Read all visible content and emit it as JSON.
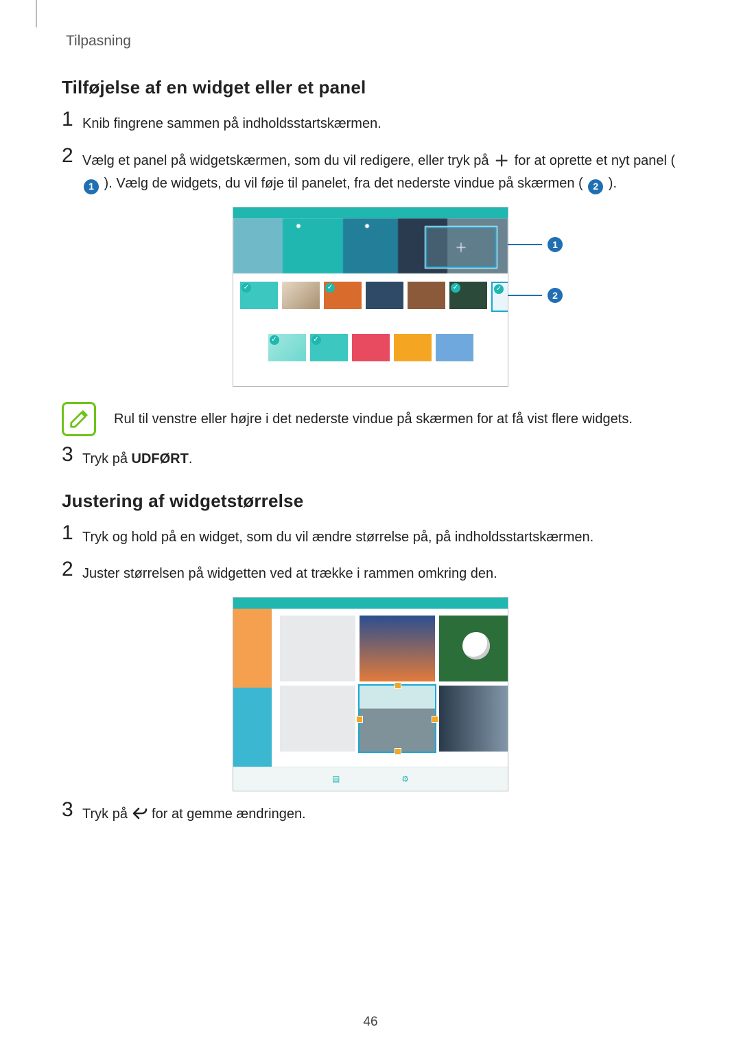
{
  "section_label": "Tilpasning",
  "heading1": "Tilføjelse af en widget eller et panel",
  "h1_steps": {
    "s1": "Knib fingrene sammen på indholdsstartskærmen.",
    "s2_a": "Vælg et panel på widgetskærmen, som du vil redigere, eller tryk på ",
    "s2_b": " for at oprette et nyt panel ( ",
    "s2_c": " ). Vælg de widgets, du vil føje til panelet, fra det nederste vindue på skærmen ( ",
    "s2_d": " ).",
    "s3_a": "Tryk på ",
    "s3_b": "UDFØRT",
    "s3_c": "."
  },
  "callout_1": "1",
  "callout_2": "2",
  "note_text": "Rul til venstre eller højre i det nederste vindue på skærmen for at få vist flere widgets.",
  "heading2": "Justering af widgetstørrelse",
  "h2_steps": {
    "s1": "Tryk og hold på en widget, som du vil ændre størrelse på, på indholdsstartskærmen.",
    "s2": "Juster størrelsen på widgetten ved at trække i rammen omkring den.",
    "s3_a": "Tryk på ",
    "s3_b": " for at gemme ændringen."
  },
  "page_number": "46",
  "step_nums": {
    "one": "1",
    "two": "2",
    "three": "3"
  },
  "plus_glyph": "＋"
}
